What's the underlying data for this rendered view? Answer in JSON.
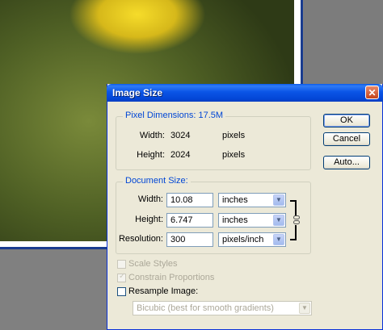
{
  "dialog": {
    "title": "Image Size"
  },
  "pixel_dimensions": {
    "title": "Pixel Dimensions:",
    "size": "17.5M",
    "width_label": "Width:",
    "width_value": "3024",
    "width_unit": "pixels",
    "height_label": "Height:",
    "height_value": "2024",
    "height_unit": "pixels"
  },
  "document_size": {
    "title": "Document Size:",
    "width_label": "Width:",
    "width_value": "10.08",
    "width_unit": "inches",
    "height_label": "Height:",
    "height_value": "6.747",
    "height_unit": "inches",
    "resolution_label": "Resolution:",
    "resolution_value": "300",
    "resolution_unit": "pixels/inch"
  },
  "buttons": {
    "ok": "OK",
    "cancel": "Cancel",
    "auto": "Auto..."
  },
  "options": {
    "scale_styles": "Scale Styles",
    "constrain_proportions": "Constrain Proportions",
    "resample_image": "Resample Image:",
    "resample_method": "Bicubic (best for smooth gradients)"
  }
}
